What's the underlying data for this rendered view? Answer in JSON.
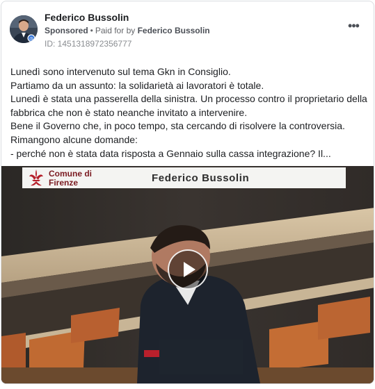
{
  "advertiser": {
    "name": "Federico Bussolin",
    "sponsored_label": "Sponsored",
    "separator": "•",
    "paid_for_prefix": "Paid for by",
    "paid_for_by": "Federico Bussolin",
    "library_id": "ID: 1451318972356777"
  },
  "menu": {
    "more_icon": "more-horizontal-icon",
    "more_glyph": "•••"
  },
  "post": {
    "lines": [
      "Lunedì sono intervenuto sul tema Gkn in Consiglio.",
      "Partiamo da un assunto: la solidarietà ai lavoratori è totale.",
      "Lunedì è stata una passerella della sinistra. Un processo contro il proprietario della",
      "fabbrica che non è stato neanche invitato a intervenire.",
      "Bene il Governo che, in poco tempo, sta cercando di risolvere la controversia.",
      "Rimangono alcune domande:",
      "- perché non è stata data risposta a Gennaio sulla cassa integrazione? Il..."
    ]
  },
  "video": {
    "banner_logo_line1": "Comune di",
    "banner_logo_line2": "Firenze",
    "banner_title": "Federico Bussolin",
    "play_icon": "play-icon"
  },
  "colors": {
    "text_primary": "#1c1e21",
    "text_secondary": "#65676b",
    "border": "#dadde1",
    "banner_logo_red": "#b51f2a"
  }
}
